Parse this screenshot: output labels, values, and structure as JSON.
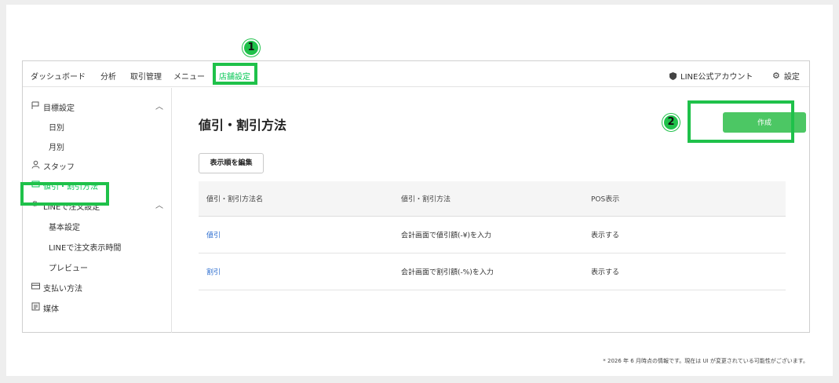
{
  "topnav": {
    "items": [
      "ダッシュボード",
      "分析",
      "取引管理",
      "メニュー",
      "店舗設定"
    ],
    "active_index": 4,
    "account_label": "LINE公式アカウント",
    "settings_label": "設定"
  },
  "sidebar": {
    "items": [
      {
        "label": "目標設定",
        "icon": "flag-icon",
        "expanded": true
      },
      {
        "label": "日別"
      },
      {
        "label": "月別"
      },
      {
        "label": "スタッフ",
        "icon": "person-icon"
      },
      {
        "label": "値引・割引方法",
        "icon": "tag-icon",
        "active": true
      },
      {
        "label": "LINEで注文設定",
        "icon": "gear-icon",
        "expanded": true
      },
      {
        "label": "基本設定"
      },
      {
        "label": "LINEで注文表示時間"
      },
      {
        "label": "プレビュー"
      },
      {
        "label": "支払い方法",
        "icon": "card-icon"
      },
      {
        "label": "媒体",
        "icon": "media-icon"
      }
    ]
  },
  "main": {
    "title": "値引・割引方法",
    "edit_order_label": "表示順を編集",
    "create_label": "作成",
    "table": {
      "headers": [
        "値引・割引方法名",
        "値引・割引方法",
        "POS表示"
      ],
      "rows": [
        [
          "値引",
          "会計画面で値引額(-¥)を入力",
          "表示する"
        ],
        [
          "割引",
          "会計画面で割引額(-%)を入力",
          "表示する"
        ]
      ]
    }
  },
  "callouts": {
    "badge1": "1",
    "badge2": "2",
    "color": "#1fc14a"
  },
  "accent_color": "#06c755",
  "footnote": "* 2026 年 6 月時点の情報です。現在は UI が変更されている可能性がございます。"
}
